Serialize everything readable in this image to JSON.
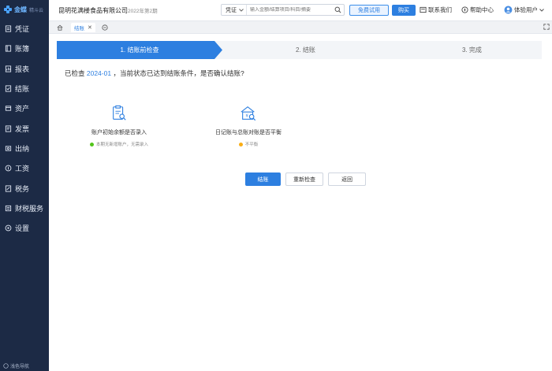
{
  "sidebar": {
    "logo": {
      "text": "金蝶",
      "sub": "精斗云"
    },
    "items": [
      {
        "label": "凭证",
        "icon": "voucher-icon"
      },
      {
        "label": "账簿",
        "icon": "book-icon"
      },
      {
        "label": "报表",
        "icon": "report-icon"
      },
      {
        "label": "结账",
        "icon": "closing-icon"
      },
      {
        "label": "资产",
        "icon": "asset-icon"
      },
      {
        "label": "发票",
        "icon": "invoice-icon"
      },
      {
        "label": "出纳",
        "icon": "cashier-icon"
      },
      {
        "label": "工资",
        "icon": "salary-icon"
      },
      {
        "label": "税务",
        "icon": "tax-icon"
      },
      {
        "label": "财税服务",
        "icon": "tax-service-icon"
      },
      {
        "label": "设置",
        "icon": "settings-icon"
      }
    ],
    "bottom_label": "浅色导航"
  },
  "header": {
    "company": "昆明花满楼食品有限公司",
    "period": "2022年第2期",
    "search": {
      "type": "凭证",
      "placeholder": "输入金额/结算项目/科目/摘要"
    },
    "trial_label": "免费试用",
    "buy_label": "购买",
    "contact_label": "联系我们",
    "help_label": "帮助中心",
    "user_label": "体验用户"
  },
  "tabs": {
    "active": "结账"
  },
  "steps": [
    {
      "label": "1. 结账前检查"
    },
    {
      "label": "2. 结账"
    },
    {
      "label": "3. 完成"
    }
  ],
  "question": {
    "prefix": "已检查 ",
    "period": "2024-01",
    "suffix": " ，当前状态已达到结账条件，是否确认结账?"
  },
  "checks": [
    {
      "title": "账户初始余额是否录入",
      "status": "本期无新增账户，无需录入",
      "status_color": "#52c41a"
    },
    {
      "title": "日记账与总账对账是否平衡",
      "status": "不平衡",
      "status_color": "#faad14"
    }
  ],
  "actions": {
    "confirm": "结账",
    "recheck": "重新检查",
    "back": "返回"
  },
  "colors": {
    "accent": "#2d7fe0",
    "sidebar": "#1c2a45"
  }
}
